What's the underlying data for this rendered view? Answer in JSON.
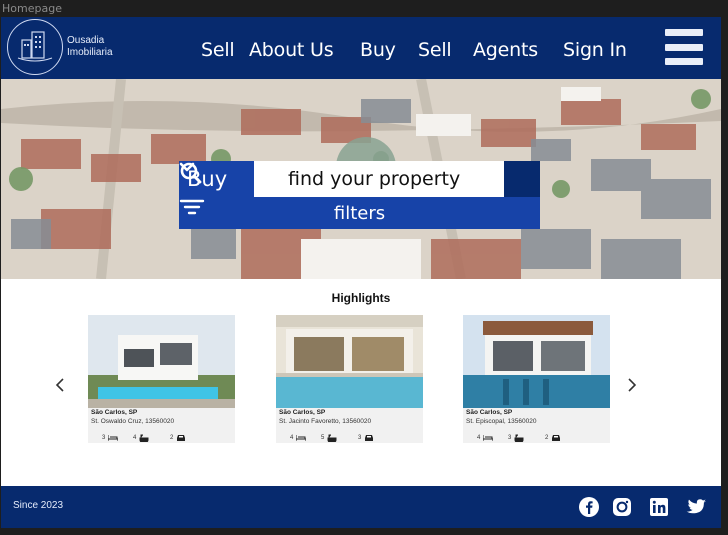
{
  "frame": {
    "label": "Homepage"
  },
  "header": {
    "brand_line1": "Ousadia",
    "brand_line2": "Imobiliaria",
    "nav": [
      "Sell",
      "About Us",
      "Buy",
      "Sell",
      "Agents",
      "Sign In"
    ],
    "menu_icon": "hamburger-menu-icon",
    "colors": {
      "navy": "#072a6e",
      "blue": "#1743a8"
    }
  },
  "hero": {
    "buy_select": "Buy",
    "search_placeholder": "find your property",
    "filters_label": "filters"
  },
  "highlights": {
    "title": "Highlights",
    "cards": [
      {
        "city": "São Carlos, SP",
        "address": "St. Oswaldo Cruz, 13560020",
        "bedrooms": "3",
        "bathrooms": "4",
        "garage": "2"
      },
      {
        "city": "São Carlos, SP",
        "address": "St. Jacinto Favoretto, 13560020",
        "bedrooms": "4",
        "bathrooms": "5",
        "garage": "3"
      },
      {
        "city": "São Carlos, SP",
        "address": "St. Episcopal, 13560020",
        "bedrooms": "4",
        "bathrooms": "3",
        "garage": "2"
      }
    ]
  },
  "footer": {
    "since": "Since 2023",
    "social": [
      "facebook-icon",
      "instagram-icon",
      "linkedin-icon",
      "twitter-icon"
    ]
  }
}
